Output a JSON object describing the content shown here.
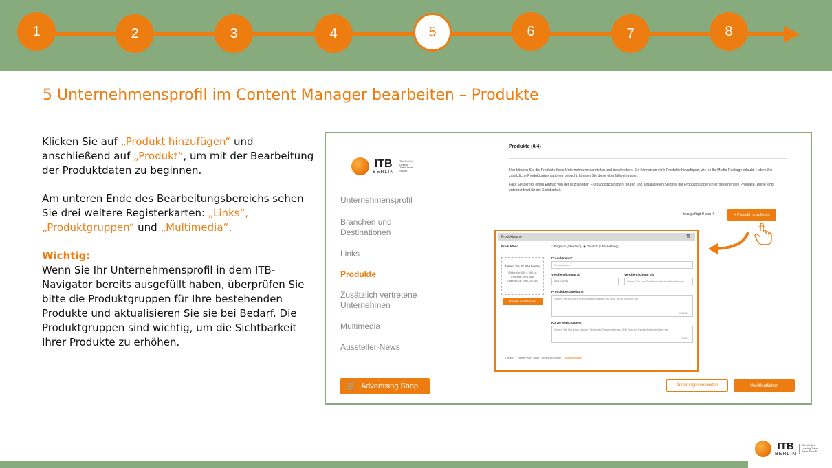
{
  "steps": [
    "1",
    "2",
    "3",
    "4",
    "5",
    "6",
    "7",
    "8"
  ],
  "active_step": "5",
  "colors": {
    "accent": "#ee7d11",
    "banner": "#88ab7d",
    "text": "#111111"
  },
  "title": "5 Unternehmensprofil im Content Manager bearbeiten – Produkte",
  "left": {
    "p1_a": "Klicken Sie auf ",
    "p1_q1": "„Produkt hinzufügen“",
    "p1_b": " und anschließend auf ",
    "p1_q2": "„Produkt“",
    "p1_c": ", um mit der Bearbeitung der Produktdaten zu beginnen.",
    "p2_a": "Am unteren Ende des Bearbeitungsbereichs sehen Sie drei weitere Registerkarten: ",
    "p2_q": "„Links“, „Produktgruppen“",
    "p2_b": " und ",
    "p2_q2": "„Multimedia“",
    "p2_c": ".",
    "wichtig": "Wichtig:",
    "p3": "Wenn Sie Ihr Unternehmensprofil in dem ITB-Navigator bereits ausgefüllt haben, überprüfen Sie bitte die Produktgruppen für Ihre bestehenden Produkte und aktualisieren Sie sie bei Bedarf. Die Produktgruppen sind wichtig, um die Sichtbarkeit Ihrer Produkte zu erhöhen."
  },
  "logo": {
    "itb": "ITB",
    "berlin": "BERLIN",
    "tagline": "The World's Leading Travel Trade Show®"
  },
  "nav": [
    {
      "label": "Unternehmensprofil",
      "active": false
    },
    {
      "label": "Branchen und Destinationen",
      "active": false
    },
    {
      "label": "Links",
      "active": false
    },
    {
      "label": "Produkte",
      "active": true
    },
    {
      "label": "Zusätzlich vertretene Unternehmen",
      "active": false
    },
    {
      "label": "Multimedia",
      "active": false
    },
    {
      "label": "Aussteller-News",
      "active": false
    }
  ],
  "advertising_shop": "Advertising Shop",
  "products": {
    "heading": "Produkte (0/4)",
    "desc1": "Hier können Sie die Produkte Ihres Unternehmens darstellen und beschreiben. Sie können so viele Produkte hinzufügen, wie es Ihr Media-Package erlaubt. Haben Sie zusätzliche Produktpräsentationen gebucht, können Sie diese ebenfalls eintragen.",
    "desc2": "Falls Sie bereits einen Eintrag von der letztjährigen Fruit Logistica haben, prüfen und aktualisieren Sie bitte die Produktgruppen Ihrer bestehenden Produkte. Diese sind entscheidend für die Sichtbarkeit.",
    "added": "Hinzugefügt 0 von 4",
    "add_button": "+ Produkt hinzufügen"
  },
  "form": {
    "header": "Produktname",
    "image_label": "Produktbild",
    "lang_en": "Englisch (Standard)",
    "lang_de": "Deutsch (Übersetzung)",
    "drop_title": "Ziehen Sie Ihr Bild hierher",
    "drop_hint": "Bildgröße 500 x 390 px Formate: jpeg, png Dateigröße: max. 20 MB",
    "browse": "Dateien durchsuchen",
    "name_label": "Produktname*",
    "name_value": "Produktname",
    "from_label": "Veröffentlichung ab",
    "from_value": "25.10.2024",
    "until_label": "Veröffentlichung bis",
    "until_placeholder": "Geben Sie das Enddatum der Veröffentlichung...",
    "desc_label": "Produktbeschreibung",
    "desc_placeholder": "Geben Sie hier Ihre Produktbeschreibung mit max. 4000 Zeichen ein.",
    "desc_counter": "0/4000",
    "short_label": "Kurzer Vorschautext",
    "short_placeholder": "Geben Sie hier einen kurzen Text oder Slogan mit max. 300 Zeichen für die Ergebnislisten ein.",
    "short_counter": "0/300",
    "tabs": [
      {
        "label": "Links",
        "active": false
      },
      {
        "label": "Branchen und Destinationen",
        "active": false
      },
      {
        "label": "Multimedia",
        "active": true
      }
    ]
  },
  "actions": {
    "discard": "Änderungen verwerfen",
    "publish": "Veröffentlichen"
  }
}
